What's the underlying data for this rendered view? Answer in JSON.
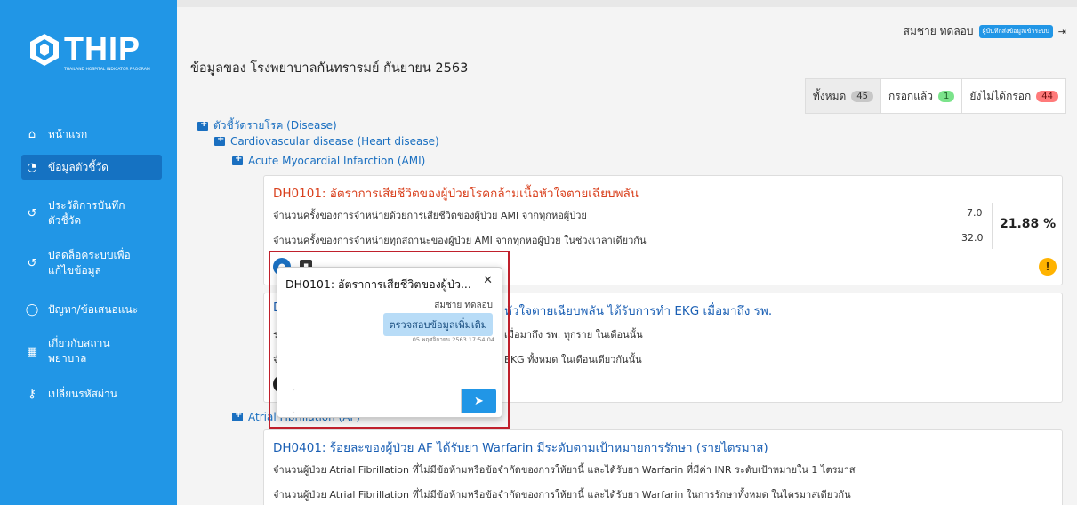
{
  "logo": {
    "title": "THIP",
    "subtitle": "THAILAND HOSPITAL INDICATOR PROGRAM"
  },
  "sidebar": {
    "items": [
      {
        "label": "หน้าแรก",
        "icon": "home-icon"
      },
      {
        "label": "ข้อมูลตัวชี้วัด",
        "icon": "dashboard-icon"
      },
      {
        "label": "ประวัติการบันทึกตัวชี้วัด",
        "icon": "history-icon"
      },
      {
        "label": "ปลดล็อคระบบเพื่อแก้ไขข้อมูล",
        "icon": "unlock-history-icon"
      },
      {
        "label": "ปัญหา/ข้อเสนอแนะ",
        "icon": "comment-icon"
      },
      {
        "label": "เกี่ยวกับสถานพยาบาล",
        "icon": "hospital-icon"
      },
      {
        "label": "เปลี่ยนรหัสผ่าน",
        "icon": "key-icon"
      }
    ]
  },
  "header": {
    "user_name": "สมชาย ทดลอบ",
    "role": "ผู้บันทึกส่งข้อมูลเข้าระบบ"
  },
  "main": {
    "title": "ข้อมูลของ โรงพยาบาลกันทรารมย์ กันยายน 2563",
    "tabs": [
      {
        "label": "ทั้งหมด",
        "count": "45"
      },
      {
        "label": "กรอกแล้ว",
        "count": "1"
      },
      {
        "label": "ยังไม่ได้กรอก",
        "count": "44"
      }
    ],
    "tree": {
      "level1": "ตัวชี้วัดรายโรค (Disease)",
      "level2": "Cardiovascular disease (Heart disease)",
      "level3": "Acute Myocardial Infarction (AMI)",
      "level3b": "Atrial Fibrillation (AF)"
    },
    "cards": [
      {
        "title": "DH0101: อัตราการเสียชีวิตของผู้ป่วยโรคกล้ามเนื้อหัวใจตายเฉียบพลัน",
        "row1": "จำนวนครั้งของการจำหน่ายด้วยการเสียชีวิตของผู้ป่วย AMI จากทุกหอผู้ป่วย",
        "row2": "จำนวนครั้งของการจำหน่ายทุกสถานะของผู้ป่วย AMI จากทุกหอผู้ป่วย ในช่วงเวลาเดียวกัน",
        "val1": "7.0",
        "val2": "32.0",
        "result": "21.88 %"
      },
      {
        "title_left": "DH",
        "title_right": "หัวใจตายเฉียบพลัน ได้รับการทำ EKG เมื่อมาถึง รพ.",
        "row1_left": "ระ",
        "row1_right": "เมื่อมาถึง รพ. ทุกราย ในเดือนนั้น",
        "row2_left": "จำ",
        "row2_right": "EKG ทั้งหมด ในเดือนเดียวกันนั้น"
      },
      {
        "title": "DH0401: ร้อยละของผู้ป่วย AF ได้รับยา Warfarin มีระดับตามเป้าหมายการรักษา (รายไตรมาส)",
        "row1": "จำนวนผู้ป่วย Atrial Fibrillation ที่ไม่มีข้อห้ามหรือข้อจำกัดของการให้ยานี้ และได้รับยา Warfarin ที่มีค่า INR ระดับเป้าหมายใน 1 ไตรมาส",
        "row2": "จำนวนผู้ป่วย Atrial Fibrillation ที่ไม่มีข้อห้ามหรือข้อจำกัดของการให้ยานี้ และได้รับยา Warfarin ในการรักษาทั้งหมด ในไตรมาสเดียวกัน"
      }
    ]
  },
  "chat": {
    "title": "DH0101: อัตราการเสียชีวิตของผู้ป่ว...",
    "sender": "สมชาย ทดลอบ",
    "message": "ตรวจสอบข้อมูลเพิ่มเติม",
    "time": "05 พฤศจิกายน 2563 17:54:04",
    "input_placeholder": ""
  },
  "colors": {
    "sidebar": "#2196e6",
    "accent": "#1a6fc0",
    "title_orange": "#d9411e",
    "highlight": "#c0202c"
  }
}
